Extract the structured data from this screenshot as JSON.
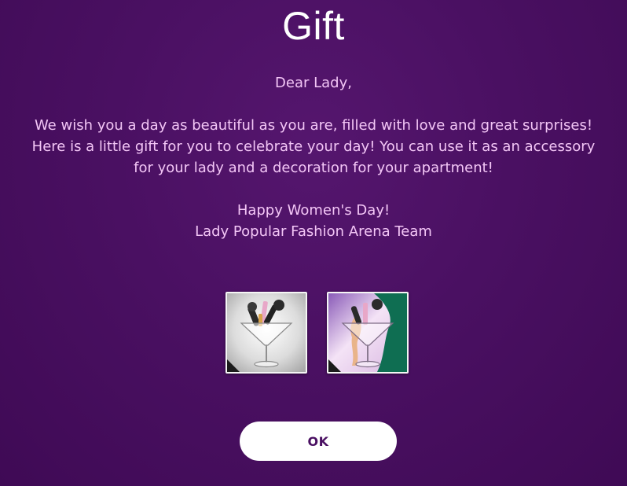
{
  "dialog": {
    "title": "Gift",
    "greeting": "Dear Lady,",
    "body_lines": [
      "We wish you a day as beautiful as you are, filled with love and great surprises!",
      "Here is a little gift for you to celebrate your day! You can use it as an accessory",
      "for your lady and a decoration for your apartment!"
    ],
    "closing": "Happy Women's Day!",
    "signature": "Lady Popular Fashion Arena Team",
    "ok_label": "OK"
  },
  "rewards": [
    {
      "icon": "cocktail-glass-accessory-icon",
      "background": "light-grey"
    },
    {
      "icon": "cocktail-glass-decoration-icon",
      "background": "purple-green"
    }
  ],
  "colors": {
    "background": "#4a1062",
    "title": "#ffffff",
    "text": "#f3c6f6",
    "button_bg": "#ffffff",
    "button_text": "#4a1062"
  }
}
